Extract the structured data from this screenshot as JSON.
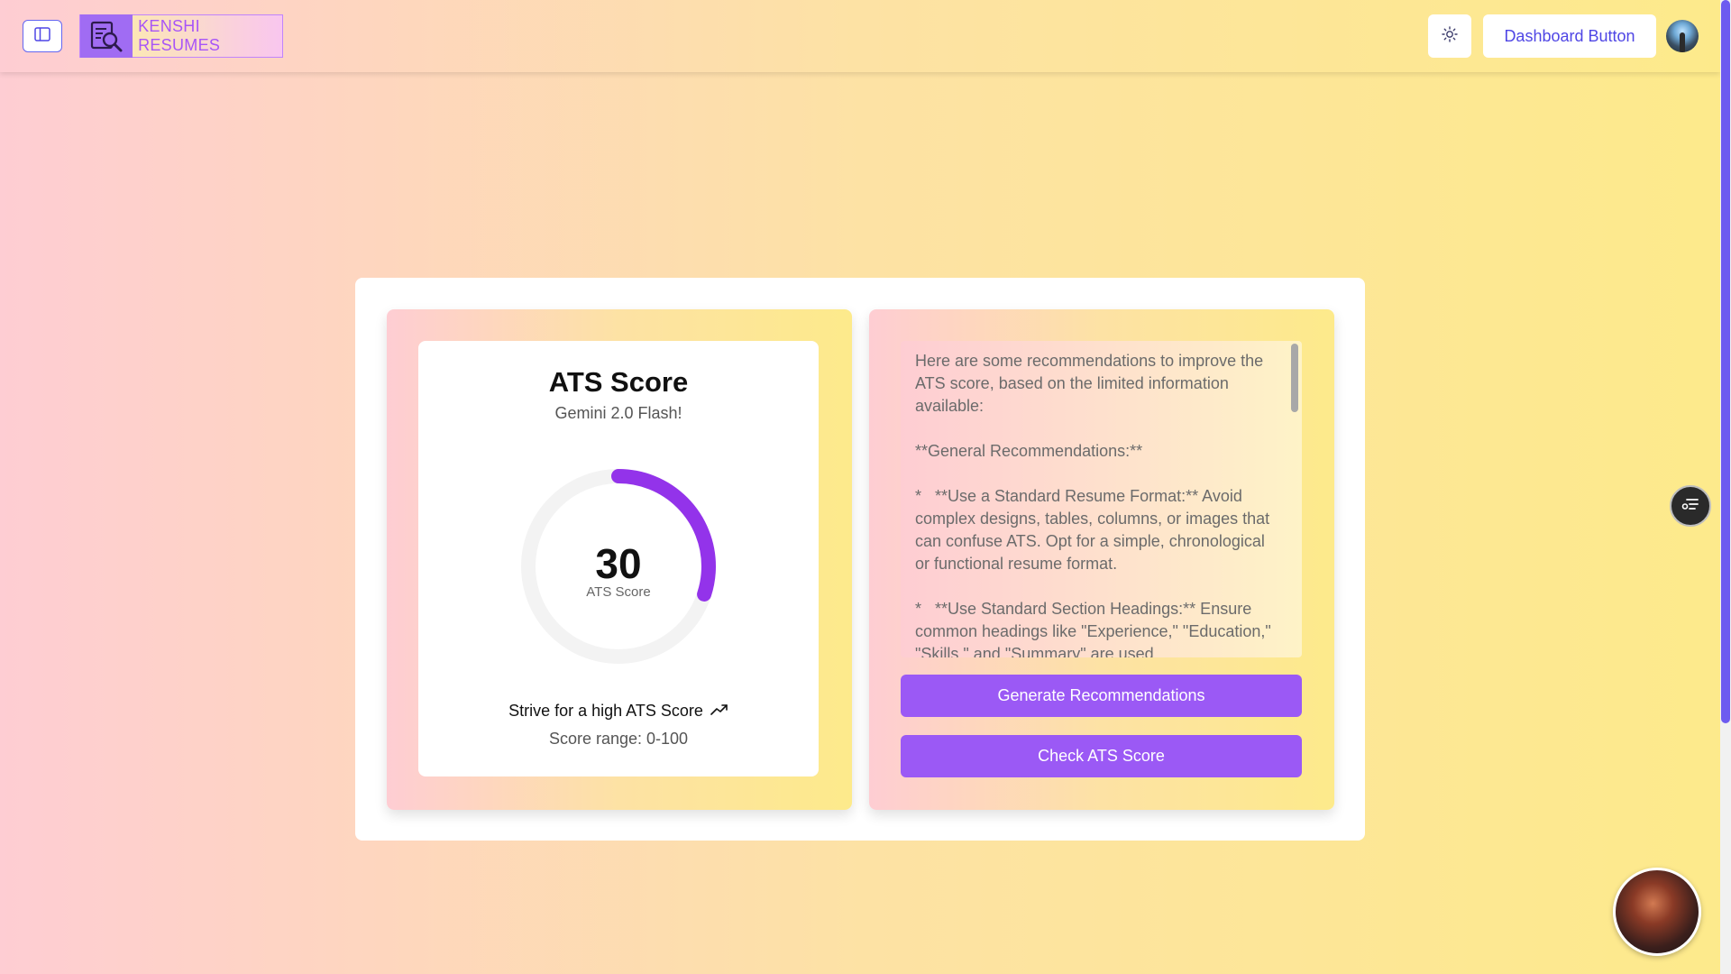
{
  "header": {
    "brand": "KENSHI RESUMES",
    "dashboard_label": "Dashboard Button",
    "icons": {
      "sidebar_toggle": "sidebar-panel-icon",
      "logo": "document-search-icon",
      "theme": "sun-icon"
    }
  },
  "score_card": {
    "title": "ATS Score",
    "subtitle": "Gemini 2.0 Flash!",
    "score": "30",
    "score_label": "ATS Score",
    "score_fraction": 0.3,
    "strive_text": "Strive for a high ATS Score",
    "range_text": "Score range: 0-100"
  },
  "recommendations": {
    "text": "Here are some recommendations to improve the ATS score, based on the limited information available:\n\n**General Recommendations:**\n\n*   **Use a Standard Resume Format:** Avoid complex designs, tables, columns, or images that can confuse ATS. Opt for a simple, chronological or functional resume format.\n\n*   **Use Standard Section Headings:** Ensure common headings like \"Experience,\" \"Education,\" \"Skills,\" and \"Summary\" are used."
  },
  "buttons": {
    "generate": "Generate Recommendations",
    "check": "Check ATS Score"
  },
  "colors": {
    "accent": "#9b59f5",
    "gauge_arc": "#9333ea",
    "gauge_track": "#f3f3f3",
    "brand_text": "#a855f7",
    "dashboard_text": "#4f46e5"
  }
}
